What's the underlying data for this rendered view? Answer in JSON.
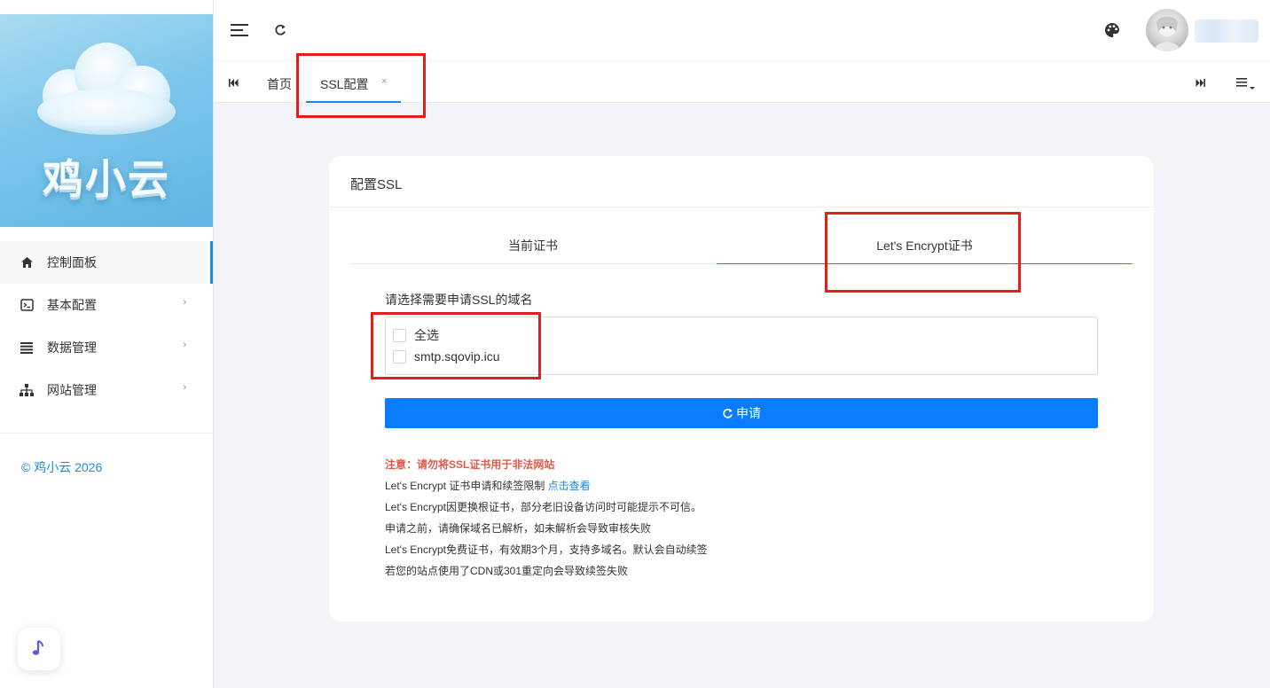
{
  "sidebar": {
    "logo_text": "鸡小云",
    "menu": [
      {
        "label": "控制面板",
        "icon": "home-icon",
        "active": true,
        "has_arrow": false
      },
      {
        "label": "基本配置",
        "icon": "terminal-icon",
        "active": false,
        "has_arrow": true
      },
      {
        "label": "数据管理",
        "icon": "list-icon",
        "active": false,
        "has_arrow": true
      },
      {
        "label": "网站管理",
        "icon": "sitemap-icon",
        "active": false,
        "has_arrow": true
      }
    ],
    "arrow_glyph": "›",
    "copyright": "© 鸡小云 2026",
    "music_icon": "music-note-icon"
  },
  "header": {
    "menu_toggle_icon": "hamburger-icon",
    "refresh_icon": "refresh-icon",
    "theme_icon": "palette-icon",
    "avatar_icon": "user-avatar"
  },
  "tabs": {
    "first_icon": "skip-first-icon",
    "home": "首页",
    "active": "SSL配置",
    "close": "×",
    "last_icon": "skip-last-icon",
    "more_icon": "tab-menu-icon"
  },
  "card": {
    "title": "配置SSL",
    "tabs": [
      "当前证书",
      "Let's Encrypt证书"
    ],
    "active_tab": 1,
    "domain_label": "请选择需要申请SSL的域名",
    "options": [
      "全选",
      "smtp.sqovip.icu"
    ],
    "apply_button": "申请",
    "notes": {
      "warning": "注意：请勿将SSL证书用于非法网站",
      "limit_text": "Let's Encrypt 证书申请和续签限制 ",
      "limit_link": "点击查看",
      "line3": "Let's Encrypt因更换根证书，部分老旧设备访问时可能提示不可信。",
      "line4": "申请之前，请确保域名已解析，如未解析会导致审核失败",
      "line5": "Let's Encrypt免费证书，有效期3个月，支持多域名。默认会自动续签",
      "line6": "若您的站点使用了CDN或301重定向会导致续签失败"
    }
  },
  "colors": {
    "accent": "#1e88e5",
    "button": "#0a7cff",
    "warning": "#e25a4a",
    "annotation": "#e0201f"
  }
}
